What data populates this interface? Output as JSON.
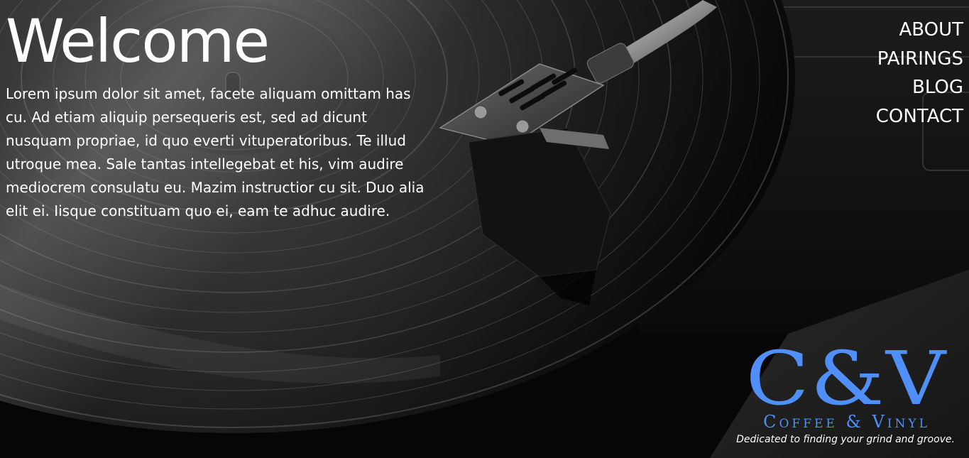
{
  "hero": {
    "title": "Welcome",
    "text": "Lorem ipsum dolor sit amet, facete aliquam omittam has cu. Ad etiam aliquip persequeris est, sed ad dicunt nusquam propriae, id quo everti vituperatoribus. Te illud utroque mea. Sale tantas intellegebat et his, vim audire mediocrem consulatu eu. Mazim instructior cu sit. Duo alia elit ei. Iisque constituam quo ei, eam te adhuc audire."
  },
  "nav": {
    "items": [
      {
        "label": "ABOUT"
      },
      {
        "label": "PAIRINGS"
      },
      {
        "label": "BLOG"
      },
      {
        "label": "CONTACT"
      }
    ]
  },
  "brand": {
    "logo": "C&V",
    "name": "Coffee & Vinyl",
    "tagline": "Dedicated to finding your grind and groove.",
    "color": "#4f8ff7"
  },
  "background": {
    "icon": "turntable-record-photo"
  }
}
